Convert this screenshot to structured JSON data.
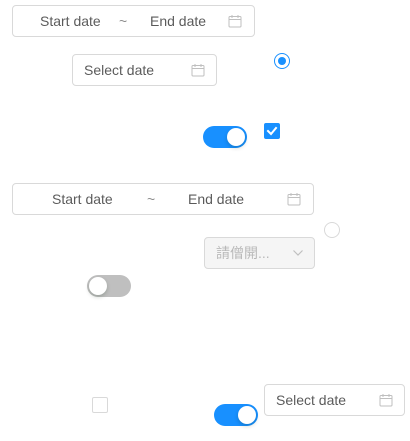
{
  "range_picker_1": {
    "start_placeholder": "Start date",
    "separator": "~",
    "end_placeholder": "End date",
    "icon": "calendar-icon"
  },
  "date_picker_1": {
    "placeholder": "Select date",
    "icon": "calendar-icon"
  },
  "radio_1": {
    "checked": true
  },
  "switch_1": {
    "checked": true
  },
  "checkbox_1": {
    "checked": true
  },
  "range_picker_2": {
    "start_placeholder": "Start date",
    "separator": "~",
    "end_placeholder": "End date",
    "icon": "calendar-icon"
  },
  "radio_2": {
    "checked": false
  },
  "select_1": {
    "placeholder": "請僧開...",
    "disabled": true,
    "icon": "chevron-down-icon"
  },
  "switch_2": {
    "checked": false
  },
  "checkbox_2": {
    "checked": false
  },
  "switch_3": {
    "checked": true
  },
  "date_picker_2": {
    "placeholder": "Select date",
    "icon": "calendar-icon"
  },
  "colors": {
    "primary": "#1890ff",
    "border": "#d9d9d9",
    "switch_off": "#bfbfbf",
    "text": "rgba(0,0,0,0.65)",
    "disabled_bg": "#f5f5f5"
  }
}
